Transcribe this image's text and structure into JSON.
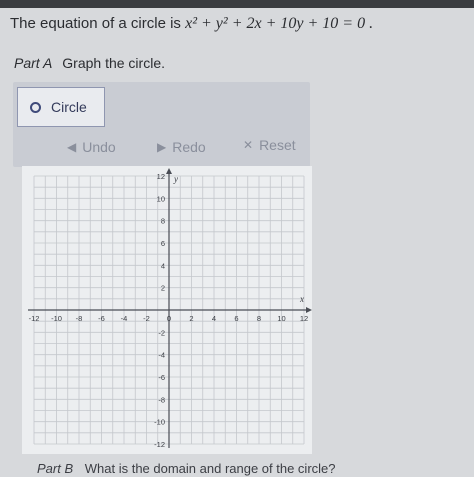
{
  "question": {
    "prefix": "The equation of a circle is",
    "equation": "x² + y² + 2x + 10y + 10 = 0 ."
  },
  "part_a": {
    "label": "Part A",
    "text": "Graph the circle."
  },
  "toolbar": {
    "circle_label": "Circle",
    "undo_label": "Undo",
    "redo_label": "Redo",
    "reset_label": "Reset"
  },
  "graph": {
    "x_axis_label": "x",
    "y_axis_label": "y",
    "x_min": -12,
    "x_max": 12,
    "y_min": -12,
    "y_max": 12,
    "x_ticks": [
      "-12",
      "-10",
      "-8",
      "-6",
      "-4",
      "-2",
      "0",
      "2",
      "4",
      "6",
      "8",
      "10",
      "12"
    ],
    "y_ticks": [
      "12",
      "10",
      "8",
      "6",
      "4",
      "2",
      "-2",
      "-4",
      "-6",
      "-8",
      "-10",
      "-12"
    ]
  },
  "part_b": {
    "label": "Part B",
    "text": "What is the domain and range of the circle?"
  },
  "colors": {
    "accent": "#3f4a7a",
    "panel": "#c9ccd3",
    "grid": "#c4c7cc"
  }
}
